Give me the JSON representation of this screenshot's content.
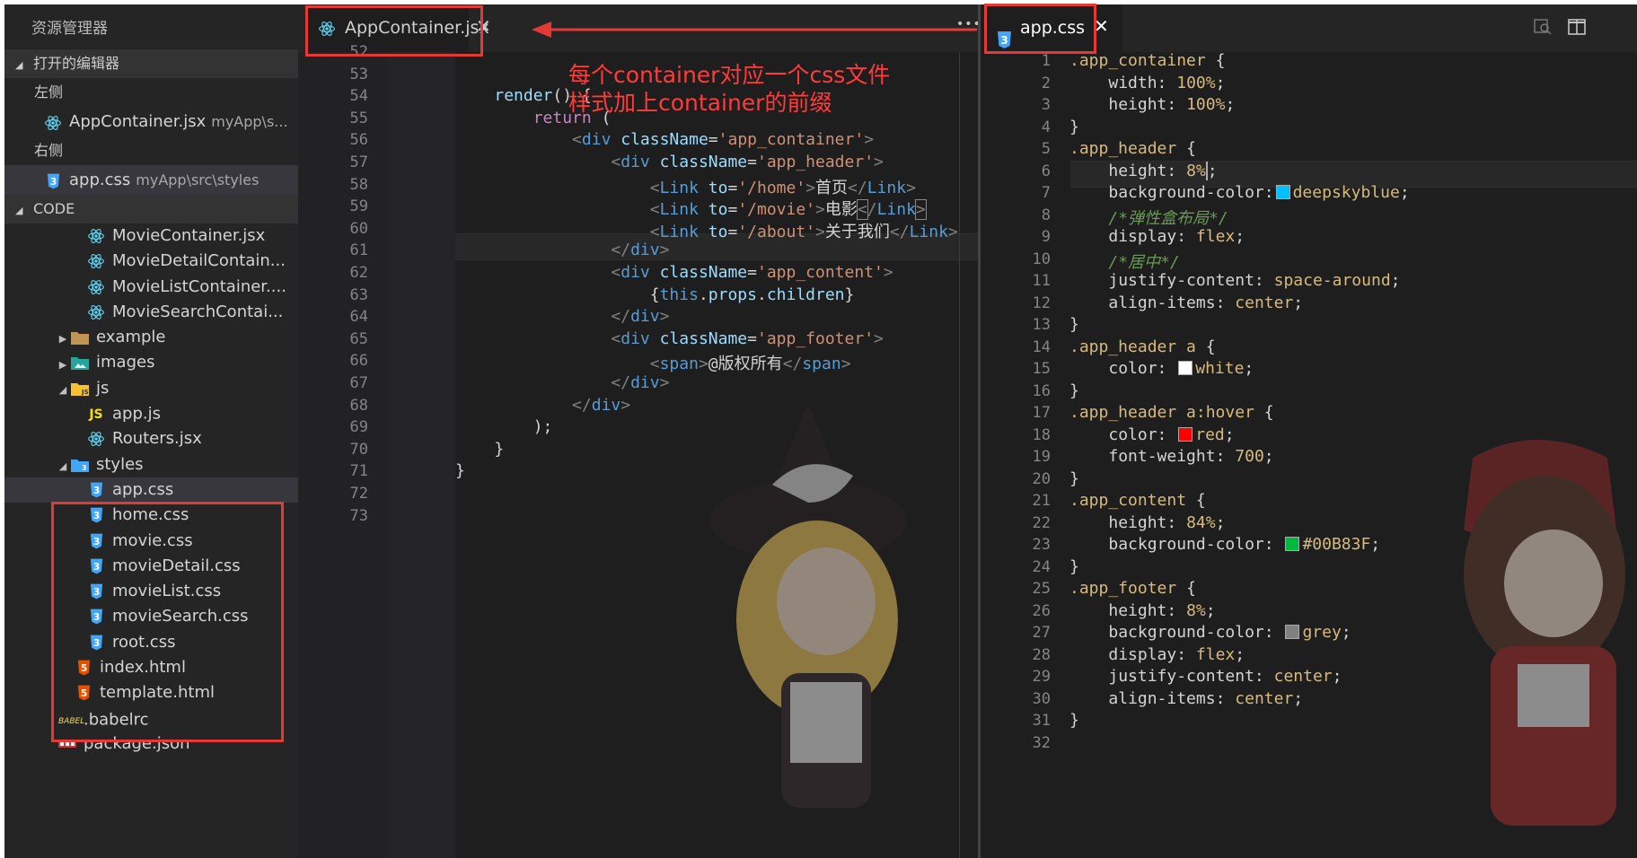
{
  "sidebar": {
    "title": "资源管理器",
    "open_editors": {
      "label": "打开的编辑器",
      "groups": [
        {
          "label": "左侧",
          "files": [
            {
              "name": "AppContainer.jsx",
              "path": "myApp\\s...",
              "icon": "react-icon"
            }
          ]
        },
        {
          "label": "右侧",
          "files": [
            {
              "name": "app.css",
              "path": "myApp\\src\\styles",
              "icon": "css-icon"
            }
          ]
        }
      ]
    },
    "code_section": {
      "label": "CODE",
      "items": [
        {
          "name": "MovieContainer.jsx",
          "icon": "react-icon",
          "indent": 3
        },
        {
          "name": "MovieDetailContain...",
          "icon": "react-icon",
          "indent": 3
        },
        {
          "name": "MovieListContainer....",
          "icon": "react-icon",
          "indent": 3
        },
        {
          "name": "MovieSearchContai...",
          "icon": "react-icon",
          "indent": 3
        },
        {
          "name": "example",
          "icon": "folder-icon",
          "indent": 2,
          "arrow": "▶"
        },
        {
          "name": "images",
          "icon": "image-folder-icon",
          "indent": 2,
          "arrow": "▶"
        },
        {
          "name": "js",
          "icon": "js-folder-icon",
          "indent": 2,
          "arrow": "◢"
        },
        {
          "name": "app.js",
          "icon": "js-icon",
          "indent": 3
        },
        {
          "name": "Routers.jsx",
          "icon": "react-icon",
          "indent": 3
        },
        {
          "name": "styles",
          "icon": "css-folder-icon",
          "indent": 2,
          "arrow": "◢"
        },
        {
          "name": "app.css",
          "icon": "css-icon",
          "indent": 3,
          "selected": true
        },
        {
          "name": "home.css",
          "icon": "css-icon",
          "indent": 3
        },
        {
          "name": "movie.css",
          "icon": "css-icon",
          "indent": 3
        },
        {
          "name": "movieDetail.css",
          "icon": "css-icon",
          "indent": 3
        },
        {
          "name": "movieList.css",
          "icon": "css-icon",
          "indent": 3
        },
        {
          "name": "movieSearch.css",
          "icon": "css-icon",
          "indent": 3
        },
        {
          "name": "root.css",
          "icon": "css-icon",
          "indent": 3
        },
        {
          "name": "index.html",
          "icon": "html-icon",
          "indent": 2
        },
        {
          "name": "template.html",
          "icon": "html-icon",
          "indent": 2
        },
        {
          "name": ".babelrc",
          "icon": "babel-icon",
          "indent": 1
        },
        {
          "name": "package.json",
          "icon": "npm-icon",
          "indent": 1
        }
      ]
    }
  },
  "editor_left": {
    "tab": {
      "label": "AppContainer.jsx",
      "icon": "react-icon"
    },
    "more_label": "•••",
    "annotation": [
      "每个container对应一个css文件",
      "样式加上container的前缀"
    ],
    "lines": [
      {
        "n": "52",
        "html": ""
      },
      {
        "n": "53",
        "html": ""
      },
      {
        "n": "54",
        "html": "    <span class='t-fn'>render</span><span class='t-pun'>() {</span>"
      },
      {
        "n": "55",
        "html": "        <span class='t-kw'>return</span> <span class='t-pun'>(</span>"
      },
      {
        "n": "56",
        "html": "            <span class='t-jsx'>&lt;</span><span class='t-tagn'>div</span> <span class='t-attr'>className</span><span class='t-pun'>=</span><span class='t-str'>'app_container'</span><span class='t-jsx'>&gt;</span>"
      },
      {
        "n": "57",
        "html": "                <span class='t-jsx'>&lt;</span><span class='t-tagn'>div</span> <span class='t-attr'>className</span><span class='t-pun'>=</span><span class='t-str'>'app_header'</span><span class='t-jsx'>&gt;</span>"
      },
      {
        "n": "58",
        "html": "                    <span class='t-jsx'>&lt;</span><span class='t-tagn'>Link</span> <span class='t-attr'>to</span><span class='t-pun'>=</span><span class='t-str'>'/home'</span><span class='t-jsx'>&gt;</span>首页<span class='t-jsx'>&lt;/</span><span class='t-tagn'>Link</span><span class='t-jsx'>&gt;</span>"
      },
      {
        "n": "59",
        "html": "                    <span class='t-jsx'>&lt;</span><span class='t-tagn'>Link</span> <span class='t-attr'>to</span><span class='t-pun'>=</span><span class='t-str'>'/movie'</span><span class='t-jsx'>&gt;</span>电影<span class='t-jsx' style='outline:1px solid #888'>&lt;</span><span class='t-jsx'>/</span><span class='t-tagn'>Link</span><span class='t-jsx' style='outline:1px solid #888'>&gt;</span>"
      },
      {
        "n": "60",
        "html": "                    <span class='t-jsx'>&lt;</span><span class='t-tagn'>Link</span> <span class='t-attr'>to</span><span class='t-pun'>=</span><span class='t-str'>'/about'</span><span class='t-jsx'>&gt;</span>关于我们<span class='t-jsx'>&lt;/</span><span class='t-tagn'>Link</span><span class='t-jsx'>&gt;</span>"
      },
      {
        "n": "61",
        "html": "                <span class='t-jsx'>&lt;/</span><span class='t-tagn'>div</span><span class='t-jsx'>&gt;</span>"
      },
      {
        "n": "62",
        "html": "                <span class='t-jsx'>&lt;</span><span class='t-tagn'>div</span> <span class='t-attr'>className</span><span class='t-pun'>=</span><span class='t-str'>'app_content'</span><span class='t-jsx'>&gt;</span>"
      },
      {
        "n": "63",
        "html": "                    <span class='t-pun'>{</span><span class='t-this'>this</span><span class='t-pun'>.</span><span class='t-attr'>props</span><span class='t-pun'>.</span><span class='t-attr'>children</span><span class='t-pun'>}</span>"
      },
      {
        "n": "64",
        "html": "                <span class='t-jsx'>&lt;/</span><span class='t-tagn'>div</span><span class='t-jsx'>&gt;</span>"
      },
      {
        "n": "65",
        "html": "                <span class='t-jsx'>&lt;</span><span class='t-tagn'>div</span> <span class='t-attr'>className</span><span class='t-pun'>=</span><span class='t-str'>'app_footer'</span><span class='t-jsx'>&gt;</span>"
      },
      {
        "n": "66",
        "html": "                    <span class='t-jsx'>&lt;</span><span class='t-tagn'>span</span><span class='t-jsx'>&gt;</span>@版权所有<span class='t-jsx'>&lt;/</span><span class='t-tagn'>span</span><span class='t-jsx'>&gt;</span>"
      },
      {
        "n": "67",
        "html": "                <span class='t-jsx'>&lt;/</span><span class='t-tagn'>div</span><span class='t-jsx'>&gt;</span>"
      },
      {
        "n": "68",
        "html": "            <span class='t-jsx'>&lt;/</span><span class='t-tagn'>div</span><span class='t-jsx'>&gt;</span>"
      },
      {
        "n": "69",
        "html": "        <span class='t-pun'>);</span>"
      },
      {
        "n": "70",
        "html": "    <span class='t-pun'>}</span>"
      },
      {
        "n": "71",
        "html": "<span class='t-pun'>}</span>"
      },
      {
        "n": "72",
        "html": ""
      },
      {
        "n": "73",
        "html": ""
      }
    ]
  },
  "editor_right": {
    "tab": {
      "label": "app.css",
      "icon": "css-icon"
    },
    "lines": [
      {
        "n": "1",
        "html": "<span class='t-sel'>.app_container</span> <span class='t-pun'>{</span>"
      },
      {
        "n": "2",
        "html": "    <span class='t-prop'>width</span><span class='t-pun'>:</span> <span class='t-num'>100%</span><span class='t-pun'>;</span>"
      },
      {
        "n": "3",
        "html": "    <span class='t-prop'>height</span><span class='t-pun'>:</span> <span class='t-num'>100%</span><span class='t-pun'>;</span>"
      },
      {
        "n": "4",
        "html": "<span class='t-pun'>}</span>"
      },
      {
        "n": "5",
        "html": "<span class='t-sel'>.app_header</span> <span class='t-pun'>{</span>"
      },
      {
        "n": "6",
        "html": "    <span class='t-prop'>height</span><span class='t-pun'>:</span> <span class='t-num'>8%</span><span class='t-pun' style='border-left:2px solid #aeafad'>;</span>"
      },
      {
        "n": "7",
        "html": "    <span class='t-prop'>background-color</span><span class='t-pun'>:</span><span class='swatch' style='background:#00bfff'></span><span class='t-num'>deepskyblue</span><span class='t-pun'>;</span>"
      },
      {
        "n": "8",
        "html": "    <span class='t-cm'>/*弹性盒布局*/</span>"
      },
      {
        "n": "9",
        "html": "    <span class='t-prop'>display</span><span class='t-pun'>:</span> <span class='t-num'>flex</span><span class='t-pun'>;</span>"
      },
      {
        "n": "10",
        "html": "    <span class='t-cm'>/*居中*/</span>"
      },
      {
        "n": "11",
        "html": "    <span class='t-prop'>justify-content</span><span class='t-pun'>:</span> <span class='t-num'>space-around</span><span class='t-pun'>;</span>"
      },
      {
        "n": "12",
        "html": "    <span class='t-prop'>align-items</span><span class='t-pun'>:</span> <span class='t-num'>center</span><span class='t-pun'>;</span>"
      },
      {
        "n": "13",
        "html": "<span class='t-pun'>}</span>"
      },
      {
        "n": "14",
        "html": "<span class='t-sel'>.app_header a</span> <span class='t-pun'>{</span>"
      },
      {
        "n": "15",
        "html": "    <span class='t-prop'>color</span><span class='t-pun'>:</span> <span class='swatch' style='background:#ffffff'></span><span class='t-num'>white</span><span class='t-pun'>;</span>"
      },
      {
        "n": "16",
        "html": "<span class='t-pun'>}</span>"
      },
      {
        "n": "17",
        "html": "<span class='t-sel'>.app_header a:hover</span> <span class='t-pun'>{</span>"
      },
      {
        "n": "18",
        "html": "    <span class='t-prop'>color</span><span class='t-pun'>:</span> <span class='swatch' style='background:#ff0000'></span><span class='t-num'>red</span><span class='t-pun'>;</span>"
      },
      {
        "n": "19",
        "html": "    <span class='t-prop'>font-weight</span><span class='t-pun'>:</span> <span class='t-num'>700</span><span class='t-pun'>;</span>"
      },
      {
        "n": "20",
        "html": "<span class='t-pun'>}</span>"
      },
      {
        "n": "21",
        "html": "<span class='t-sel'>.app_content</span> <span class='t-pun'>{</span>"
      },
      {
        "n": "22",
        "html": "    <span class='t-prop'>height</span><span class='t-pun'>:</span> <span class='t-num'>84%</span><span class='t-pun'>;</span>"
      },
      {
        "n": "23",
        "html": "    <span class='t-prop'>background-color</span><span class='t-pun'>:</span> <span class='swatch' style='background:#00b83f'></span><span class='t-num'>#00B83F</span><span class='t-pun'>;</span>"
      },
      {
        "n": "24",
        "html": "<span class='t-pun'>}</span>"
      },
      {
        "n": "25",
        "html": "<span class='t-sel'>.app_footer</span> <span class='t-pun'>{</span>"
      },
      {
        "n": "26",
        "html": "    <span class='t-prop'>height</span><span class='t-pun'>:</span> <span class='t-num'>8%</span><span class='t-pun'>;</span>"
      },
      {
        "n": "27",
        "html": "    <span class='t-prop'>background-color</span><span class='t-pun'>:</span> <span class='swatch' style='background:#808080'></span><span class='t-num'>grey</span><span class='t-pun'>;</span>"
      },
      {
        "n": "28",
        "html": "    <span class='t-prop'>display</span><span class='t-pun'>:</span> <span class='t-num'>flex</span><span class='t-pun'>;</span>"
      },
      {
        "n": "29",
        "html": "    <span class='t-prop'>justify-content</span><span class='t-pun'>:</span> <span class='t-num'>center</span><span class='t-pun'>;</span>"
      },
      {
        "n": "30",
        "html": "    <span class='t-prop'>align-items</span><span class='t-pun'>:</span> <span class='t-num'>center</span><span class='t-pun'>;</span>"
      },
      {
        "n": "31",
        "html": "<span class='t-pun'>}</span>"
      },
      {
        "n": "32",
        "html": ""
      }
    ]
  },
  "colors": {
    "accent_red": "#e53935",
    "editor_bg": "#1e1e1e",
    "sidebar_bg": "#252526"
  }
}
